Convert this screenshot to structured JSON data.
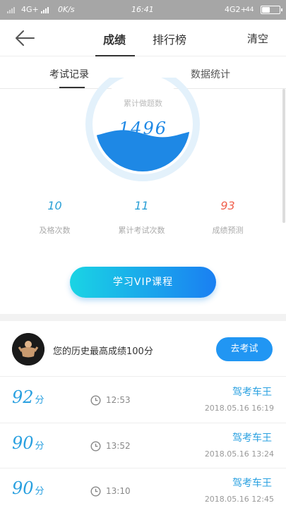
{
  "status_bar": {
    "network_left": "4G+",
    "speed": "0K/s",
    "time": "16:41",
    "network_right": "4G2+",
    "battery": "44"
  },
  "nav": {
    "tabs": [
      "成绩",
      "排行榜"
    ],
    "active_tab": 0,
    "clear_label": "清空"
  },
  "subtabs": {
    "items": [
      "考试记录",
      "数据统计"
    ],
    "active": 0
  },
  "gauge": {
    "label": "累计做题数",
    "value": "1496",
    "fill_fraction": 0.4
  },
  "stats": [
    {
      "value": "10",
      "label": "及格次数",
      "color": "#2a9fd6"
    },
    {
      "value": "11",
      "label": "累计考试次数",
      "color": "#2a9fd6"
    },
    {
      "value": "93",
      "label": "成绩预测",
      "color": "#f0624f"
    }
  ],
  "vip_button": "学习VIP课程",
  "best": {
    "text": "您的历史最高成绩100分",
    "button": "去考试"
  },
  "records": [
    {
      "score": "92",
      "unit": "分",
      "time": "12:53",
      "title": "驾考车王",
      "date": "2018.05.16   16:19"
    },
    {
      "score": "90",
      "unit": "分",
      "time": "13:52",
      "title": "驾考车王",
      "date": "2018.05.16   13:24"
    },
    {
      "score": "90",
      "unit": "分",
      "time": "13:10",
      "title": "驾考车王",
      "date": "2018.05.16   12:45"
    }
  ],
  "colors": {
    "accent": "#2196f3",
    "gauge_fill": "#1e88e5",
    "gauge_ring": "#e3f1fb",
    "prediction": "#f0624f"
  }
}
